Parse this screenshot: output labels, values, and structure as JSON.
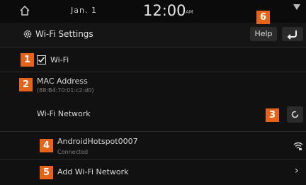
{
  "status": {
    "date": "Jan.  1",
    "time": "12:00",
    "ampm": "AM"
  },
  "header": {
    "title": "Wi-Fi Settings",
    "help_label": "Help"
  },
  "rows": {
    "wifi": {
      "label": "Wi-Fi",
      "checked": true
    },
    "mac": {
      "label": "MAC Address",
      "value": "(88:B4:70:01:c2:d0)"
    },
    "network": {
      "label": "Wi-Fi Network"
    },
    "hotspot": {
      "name": "AndroidHotspot0007",
      "status": "Connected"
    },
    "add": {
      "label": "Add Wi-Fi Network"
    }
  },
  "callouts": [
    "1",
    "2",
    "3",
    "4",
    "5",
    "6"
  ],
  "colors": {
    "accent": "#e5641a",
    "background": "#111111"
  }
}
